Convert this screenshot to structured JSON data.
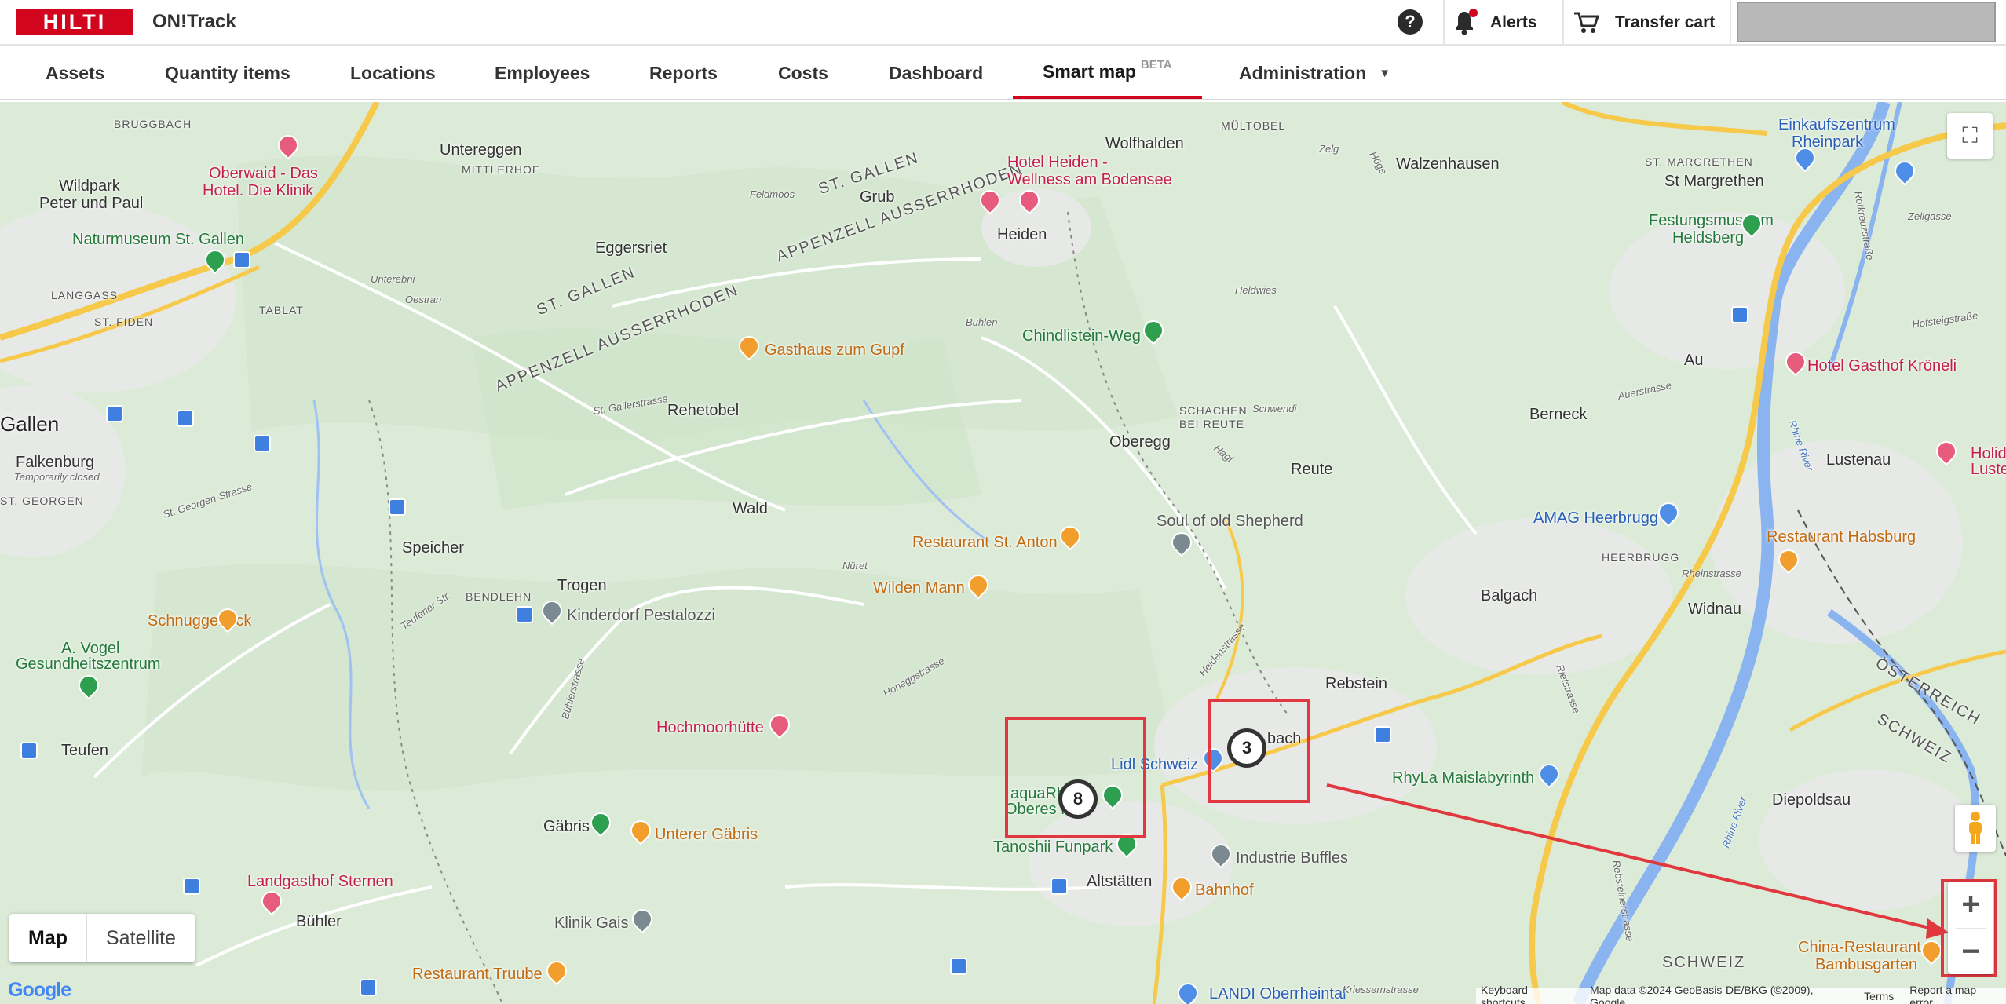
{
  "header": {
    "logo_text": "HILTI",
    "app_name": "ON!Track",
    "help_label": "?",
    "alerts_label": "Alerts",
    "transfer_cart_label": "Transfer cart",
    "brand_color": "#d2051e"
  },
  "nav": {
    "items": [
      {
        "label": "Assets"
      },
      {
        "label": "Quantity items"
      },
      {
        "label": "Locations"
      },
      {
        "label": "Employees"
      },
      {
        "label": "Reports"
      },
      {
        "label": "Costs"
      },
      {
        "label": "Dashboard"
      },
      {
        "label": "Smart map",
        "badge": "BETA",
        "active": true
      },
      {
        "label": "Administration"
      }
    ],
    "caret": "▼"
  },
  "map": {
    "clusters": [
      {
        "count": "8"
      },
      {
        "count": "3"
      }
    ],
    "type_buttons": {
      "map": "Map",
      "satellite": "Satellite"
    },
    "zoom_in": "+",
    "zoom_out": "−",
    "fullscreen_icon": "⛶",
    "google_logo": "Google",
    "attribution": {
      "shortcuts": "Keyboard shortcuts",
      "data": "Map data ©2024 GeoBasis-DE/BKG (©2009), Google",
      "terms": "Terms",
      "report": "Report a map error"
    },
    "labels": {
      "bruggbach": "BRUGGBACH",
      "untereggen": "Untereggen",
      "mittlerhof": "MITTLERHOF",
      "wolfhalden": "Wolfhalden",
      "multobel": "MÜLTOBEL",
      "walzenhausen": "Walzenhausen",
      "st_margrethen_caps": "ST. MARGRETHEN",
      "st_margrethen": "St Margrethen",
      "wildpark": "Wildpark",
      "peter_paul": "Peter und Paul",
      "oberwaid_1": "Oberwaid - Das",
      "oberwaid_2": "Hotel. Die Klinik",
      "st_gallen_region": "ST. GALLEN",
      "grub": "Grub",
      "feldmoos": "Feldmoos",
      "appenzell_ar_1": "APPENZELL AUSSERRHODEN",
      "hotel_heiden_1": "Hotel Heiden -",
      "hotel_heiden_2": "Wellness am Bodensee",
      "heiden": "Heiden",
      "naturmuseum": "Naturmuseum St. Gallen",
      "eggersriet": "Eggersriet",
      "langgass": "LANGGASS",
      "st_fiden": "ST. FIDEN",
      "tablat": "TABLAT",
      "unterebni": "Unterebni",
      "oestran": "Oestran",
      "st_gallen_region2": "ST. GALLEN",
      "appenzell_ar_2": "APPENZELL AUSSERRHODEN",
      "buhlen": "Bühlen",
      "heldwies": "Heldwies",
      "chindlistein": "Chindlistein-Weg",
      "gasthaus_gupf": "Gasthaus zum Gupf",
      "einkaufszentrum_1": "Einkaufszentrum",
      "einkaufszentrum_2": "Rheinpark",
      "festungsmuseum_1": "Festungsmuseum",
      "festungsmuseum_2": "Heldsberg",
      "zelg": "Zelg",
      "hoge": "Höge",
      "gallen": "Gallen",
      "st_gallerstrasse": "St. Gallerstrasse",
      "rehetobel": "Rehetobel",
      "schachen": "SCHACHEN",
      "bei_reute": "BEI REUTE",
      "schwendi": "Schwendi",
      "au": "Au",
      "hotel_gasthof": "Hotel Gasthof Kröneli",
      "falkenburg": "Falkenburg",
      "temp_closed": "Temporarily closed",
      "oberegg": "Oberegg",
      "hagi": "Hagi",
      "berneck": "Berneck",
      "auerstrasse": "Auerstrasse",
      "lustenau": "Lustenau",
      "holiday_1": "Holiday",
      "holiday_2": "Lustena",
      "st_georgen": "ST. GEORGEN",
      "st_georgenstrasse": "St. Georgen-Strasse",
      "reute": "Reute",
      "wald": "Wald",
      "soul_shepherd": "Soul of old Shepherd",
      "amag": "AMAG Heerbrugg",
      "heerbrugg": "HEERBRUGG",
      "rest_habsburg": "Restaurant Habsburg",
      "speicher": "Speicher",
      "rest_st_anton": "Restaurant St. Anton",
      "nuret": "Nüret",
      "rheinstrasse": "Rheinstrasse",
      "trogen": "Trogen",
      "bendlehn": "BENDLEHN",
      "teufener": "Teufener Str.",
      "wilden_mann": "Wilden Mann",
      "balgach": "Balgach",
      "widnau": "Widnau",
      "kinderdorf": "Kinderdorf Pestalozzi",
      "schnuggebock": "Schnuggebock",
      "heidenstrasse": "Heidenstrasse",
      "avogel_1": "A. Vogel",
      "avogel_2": "Gesundheitszentrum",
      "honeggstrasse": "Honeggstrasse",
      "rebstein": "Rebstein",
      "osterreich": "ÖSTERREICH",
      "buhlerstrasse": "Bühlerstrasse",
      "marbach_part": "bach",
      "hochmoorhutte": "Hochmoorhütte",
      "teufen": "Teufen",
      "lidl": "Lidl Schweiz",
      "rhyla": "RhyLa Maislabyrinth",
      "schweiz_vert": "SCHWEIZ",
      "aquarh_1": "aquaRh",
      "aquarh_2": "Oberes Rh",
      "diepoldsau": "Diepoldsau",
      "gabris": "Gäbris",
      "unterer_gabris": "Unterer Gäbris",
      "tanoshii": "Tanoshii Funpark",
      "industrie": "Industrie Buffles",
      "landgasthof": "Landgasthof Sternen",
      "altstatten": "Altstätten",
      "bahnhof": "Bahnhof",
      "buhler": "Bühler",
      "klinik_gais": "Klinik Gais",
      "china_rest_1": "China-Restaurant",
      "china_rest_2": "Bambusgarten",
      "schweiz": "SCHWEIZ",
      "rest_truube": "Restaurant Truube",
      "landi": "LANDI Oberrheintal",
      "kriessern": "Kriessernstrasse",
      "rietstrasse": "Rietstrasse",
      "rebsteinerstrasse": "Rebsteinerstrasse",
      "rhine_river": "Rhine River",
      "rotkreuzstrasse": "Rotkreuzstraße",
      "zellgasse": "Zellgasse",
      "hofsteigstrasse": "Hofsteigstraße"
    },
    "colors": {
      "land": "#dcebd8",
      "water": "#8ab4f0",
      "highway": "#f6c94a",
      "highlight": "#e0383e"
    }
  }
}
